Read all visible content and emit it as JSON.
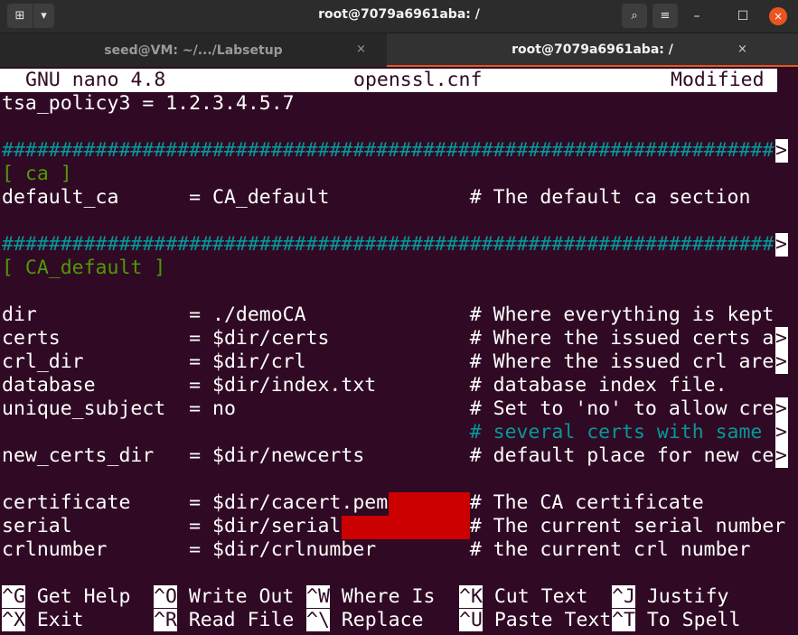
{
  "window": {
    "title": "root@7079a6961aba: /",
    "tabs": [
      {
        "label": "seed@VM: ~/.../Labsetup",
        "close": "×"
      },
      {
        "label": "root@7079a6961aba: /",
        "close": "×"
      }
    ],
    "controls": {
      "search": "⌕",
      "menu": "≡",
      "minimize": "–",
      "maximize": "☐",
      "close": "×",
      "new_tab": "⊞",
      "dropdown": "▾"
    }
  },
  "nano": {
    "header_app": "GNU nano 4.8",
    "header_file": "openssl.cnf",
    "header_status": "Modified",
    "overflow_marker": ">",
    "lines": [
      "tsa_policy3 = 1.2.3.4.5.7",
      "",
      "##################################################################",
      "[ ca ]",
      "default_ca      = CA_default            # The default ca section",
      "",
      "##################################################################",
      "[ CA_default ]",
      "",
      "dir             = ./demoCA              # Where everything is kept",
      "certs           = $dir/certs            # Where the issued certs a",
      "crl_dir         = $dir/crl              # Where the issued crl are",
      "database        = $dir/index.txt        # database index file.",
      "unique_subject  = no                    # Set to 'no' to allow cre",
      "                                        # several certs with same ",
      "new_certs_dir   = $dir/newcerts         # default place for new ce",
      "",
      "certificate     = $dir/cacert.pem       # The CA certificate",
      "serial          = $dir/serial           # The current serial number",
      "crlnumber       = $dir/crlnumber        # the current crl number"
    ],
    "shortcuts_row1": [
      {
        "key": "^G",
        "label": "Get Help"
      },
      {
        "key": "^O",
        "label": "Write Out"
      },
      {
        "key": "^W",
        "label": "Where Is"
      },
      {
        "key": "^K",
        "label": "Cut Text"
      },
      {
        "key": "^J",
        "label": "Justify"
      }
    ],
    "shortcuts_row2": [
      {
        "key": "^X",
        "label": "Exit"
      },
      {
        "key": "^R",
        "label": "Read File"
      },
      {
        "key": "^\\",
        "label": "Replace"
      },
      {
        "key": "^U",
        "label": "Paste Text"
      },
      {
        "key": "^T",
        "label": "To Spell"
      }
    ]
  }
}
